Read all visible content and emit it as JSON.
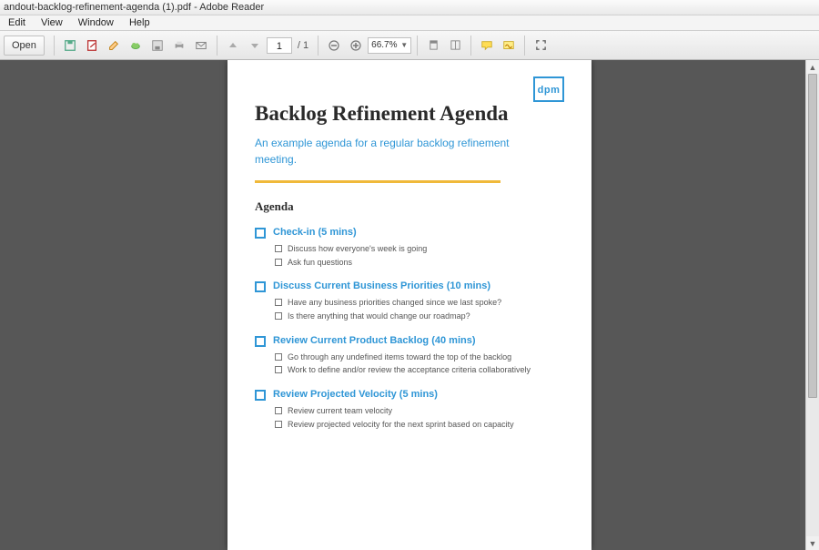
{
  "window": {
    "title": "andout-backlog-refinement-agenda (1).pdf - Adobe Reader"
  },
  "menu": {
    "items": [
      "Edit",
      "View",
      "Window",
      "Help"
    ]
  },
  "toolbar": {
    "open_label": "Open",
    "page_current": "1",
    "page_total": "/ 1",
    "zoom_value": "66.7%"
  },
  "document": {
    "logo": "dpm",
    "title": "Backlog Refinement Agenda",
    "subtitle": "An example agenda for a regular backlog refinement meeting.",
    "agenda_heading": "Agenda",
    "sections": [
      {
        "title": "Check-in (5 mins)",
        "items": [
          "Discuss how everyone's week is going",
          "Ask fun questions"
        ]
      },
      {
        "title": "Discuss Current Business Priorities (10 mins)",
        "items": [
          "Have any business priorities changed since we last spoke?",
          "Is there anything that would change our roadmap?"
        ]
      },
      {
        "title": "Review Current Product Backlog (40 mins)",
        "items": [
          "Go through any undefined items toward the top of the backlog",
          "Work to define and/or review the acceptance criteria collaboratively"
        ]
      },
      {
        "title": "Review Projected Velocity (5 mins)",
        "items": [
          "Review current team velocity",
          "Review projected velocity for the next sprint based on capacity"
        ]
      }
    ]
  }
}
